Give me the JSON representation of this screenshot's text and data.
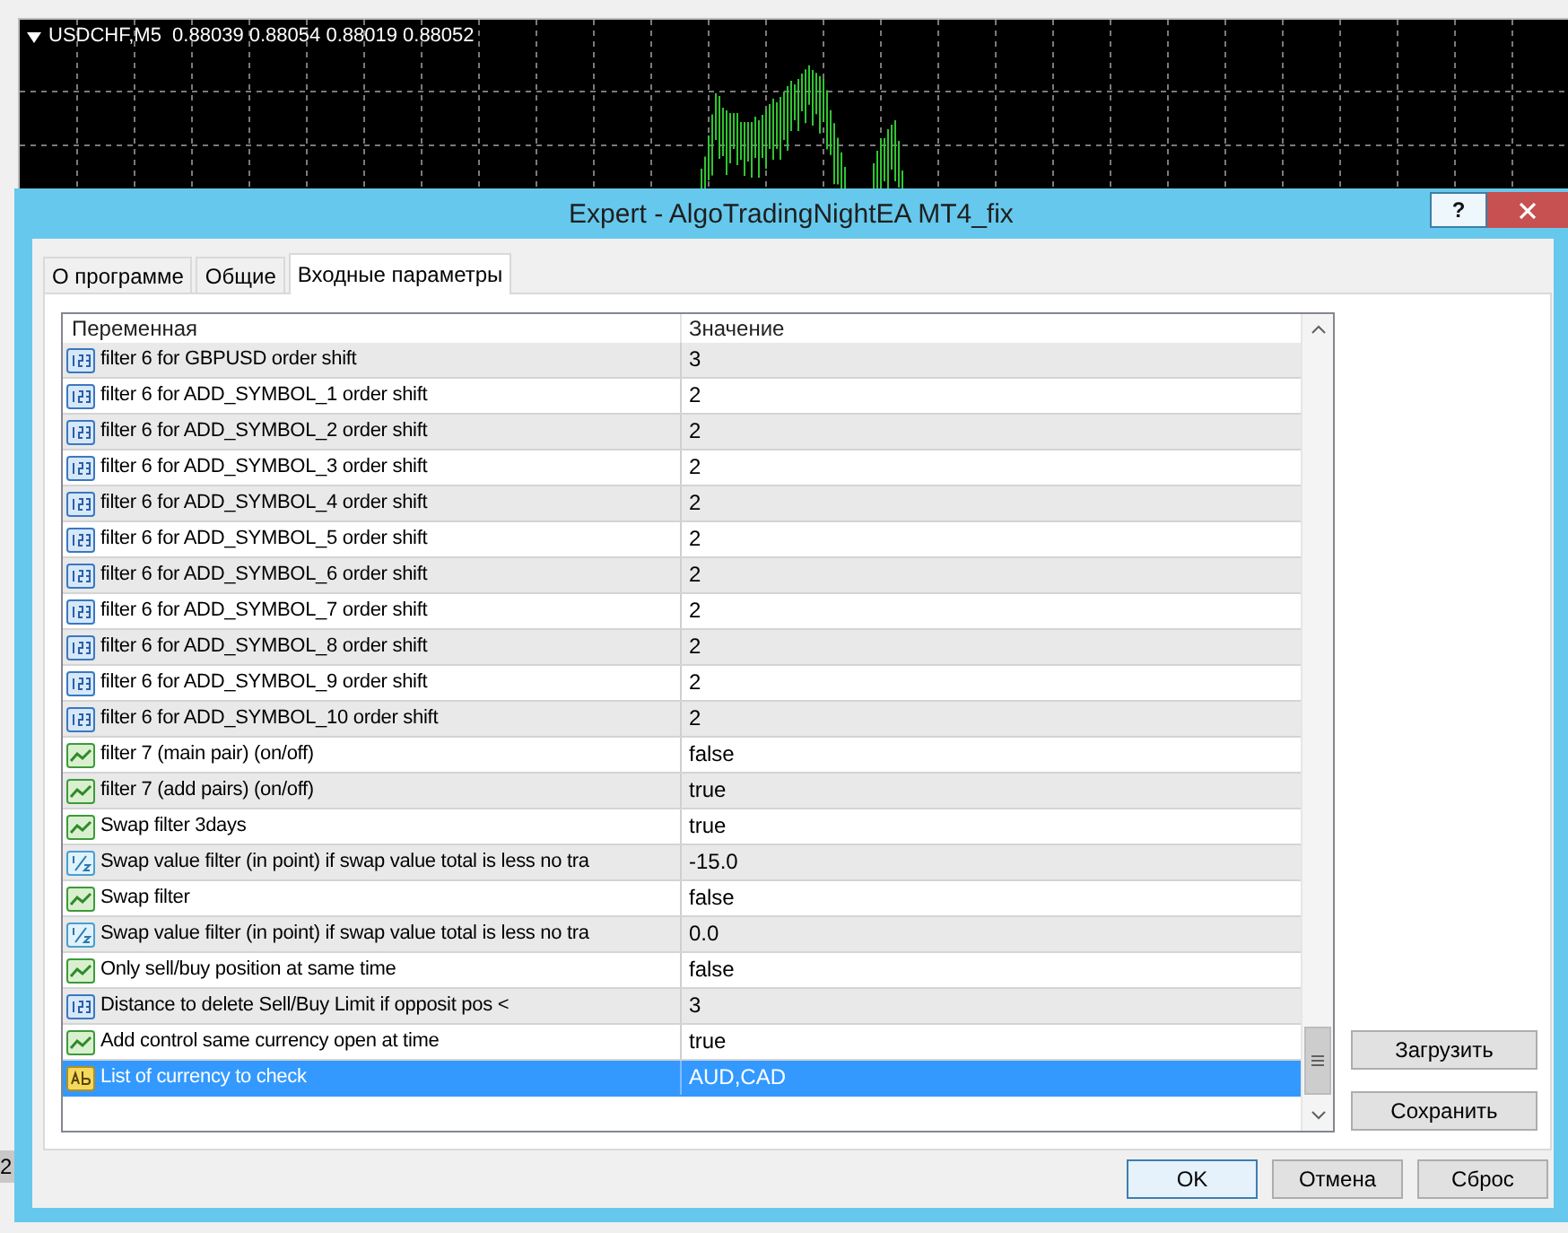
{
  "background_window": {
    "cell_fragment": "2"
  },
  "chart": {
    "title": "USDCHF,M5  0.88039 0.88054 0.88019 0.88052"
  },
  "dialog": {
    "title": "Expert - AlgoTradingNightEA MT4_fix",
    "help_button": "?",
    "tabs": [
      {
        "label": "О программе",
        "selected": false
      },
      {
        "label": "Общие",
        "selected": false
      },
      {
        "label": "Входные параметры",
        "selected": true
      }
    ],
    "table": {
      "columns": [
        "Переменная",
        "Значение"
      ],
      "rows": [
        {
          "kind": "int",
          "name": "filter 6 for GBPUSD order shift",
          "value": "3",
          "selected": false
        },
        {
          "kind": "int",
          "name": "filter 6 for ADD_SYMBOL_1 order shift",
          "value": "2",
          "selected": false
        },
        {
          "kind": "int",
          "name": "filter 6 for ADD_SYMBOL_2 order shift",
          "value": "2",
          "selected": false
        },
        {
          "kind": "int",
          "name": "filter 6 for ADD_SYMBOL_3 order shift",
          "value": "2",
          "selected": false
        },
        {
          "kind": "int",
          "name": "filter 6 for ADD_SYMBOL_4 order shift",
          "value": "2",
          "selected": false
        },
        {
          "kind": "int",
          "name": "filter 6 for ADD_SYMBOL_5 order shift",
          "value": "2",
          "selected": false
        },
        {
          "kind": "int",
          "name": "filter 6 for ADD_SYMBOL_6 order shift",
          "value": "2",
          "selected": false
        },
        {
          "kind": "int",
          "name": "filter 6 for ADD_SYMBOL_7 order shift",
          "value": "2",
          "selected": false
        },
        {
          "kind": "int",
          "name": "filter 6 for ADD_SYMBOL_8 order shift",
          "value": "2",
          "selected": false
        },
        {
          "kind": "int",
          "name": "filter 6 for ADD_SYMBOL_9 order shift",
          "value": "2",
          "selected": false
        },
        {
          "kind": "int",
          "name": "filter 6 for ADD_SYMBOL_10 order shift",
          "value": "2",
          "selected": false
        },
        {
          "kind": "bool",
          "name": "filter 7 (main pair) (on/off)",
          "value": "false",
          "selected": false
        },
        {
          "kind": "bool",
          "name": "filter 7 (add pairs) (on/off)",
          "value": "true",
          "selected": false
        },
        {
          "kind": "bool",
          "name": "Swap filter 3days",
          "value": "true",
          "selected": false
        },
        {
          "kind": "double",
          "name": "Swap value filter (in point) if swap value total is less no tra",
          "value": "-15.0",
          "selected": false
        },
        {
          "kind": "bool",
          "name": "Swap filter",
          "value": "false",
          "selected": false
        },
        {
          "kind": "double",
          "name": "Swap value filter (in point) if swap value total is less no tra",
          "value": "0.0",
          "selected": false
        },
        {
          "kind": "bool",
          "name": "Only sell/buy position at same time",
          "value": "false",
          "selected": false
        },
        {
          "kind": "int",
          "name": "Distance to delete Sell/Buy Limit if opposit pos <",
          "value": "3",
          "selected": false
        },
        {
          "kind": "bool",
          "name": "Add control same currency open at time",
          "value": "true",
          "selected": false
        },
        {
          "kind": "string",
          "name": "List of currency to check",
          "value": "AUD,CAD",
          "selected": true
        }
      ]
    },
    "side_buttons": [
      "Загрузить",
      "Сохранить"
    ],
    "footer_buttons": [
      {
        "label": "OK",
        "default": true
      },
      {
        "label": "Отмена",
        "default": false
      },
      {
        "label": "Сброс",
        "default": false
      }
    ]
  }
}
